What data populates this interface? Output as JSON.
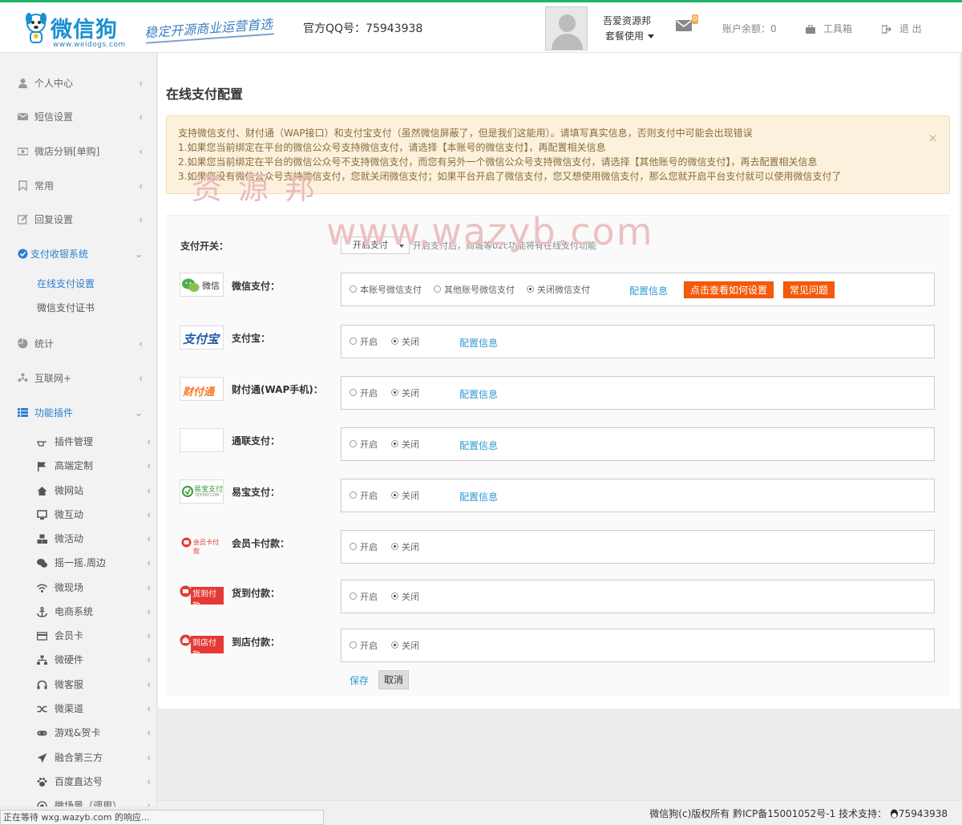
{
  "header": {
    "logo_text": "微信狗",
    "logo_sub": "www.weidogs.com",
    "slogan": "稳定开源商业运营首选",
    "qq_label": "官方QQ号：75943938",
    "user_name": "吾爱资源邦",
    "user_plan": "套餐使用",
    "mail_count": "0",
    "balance": "账户余额：0",
    "toolbox": "工具箱",
    "logout": "退 出"
  },
  "sidebar": {
    "items": [
      {
        "label": "个人中心"
      },
      {
        "label": "短信设置"
      },
      {
        "label": "微店分销[单购]"
      },
      {
        "label": "常用"
      },
      {
        "label": "回复设置"
      },
      {
        "label": "支付收银系统"
      },
      {
        "label": "统计"
      },
      {
        "label": "互联网+"
      },
      {
        "label": "功能插件"
      }
    ],
    "pay_sub": [
      "在线支付设置",
      "微信支付证书"
    ],
    "plugins": [
      "插件管理",
      "高端定制",
      "微网站",
      "微互动",
      "微活动",
      "摇一摇.周边",
      "微现场",
      "电商系统",
      "会员卡",
      "微硬件",
      "微客服",
      "微渠道",
      "游戏&贺卡",
      "融合第三方",
      "百度直达号",
      "微场景（调用）"
    ]
  },
  "main": {
    "title": "在线支付配置",
    "alert_lines": [
      "支持微信支付、财付通（WAP接口）和支付宝支付（虽然微信屏蔽了，但是我们这能用）。请填写真实信息，否则支付中可能会出现错误",
      "1.如果您当前绑定在平台的微信公众号支持微信支付，请选择【本账号的微信支付】，再配置相关信息",
      "2.如果您当前绑定在平台的微信公众号不支持微信支付，而您有另外一个微信公众号支持微信支付，请选择【其他账号的微信支付】，再去配置相关信息",
      "3.如果您没有微信公众号支持微信支付，您就关闭微信支付；如果平台开启了微信支付，您又想使用微信支付，那么您就开启平台支付就可以使用微信支付了"
    ],
    "alert_close": "×",
    "watermark_top": "资源邦",
    "watermark_main": "www.wazyb.com",
    "switch": {
      "label": "支付开关：",
      "selected": "开启支付",
      "help": "开启支付后，商城等b2c功能将有在线支付功能"
    },
    "wechat": {
      "logo_text": "微信",
      "label": "微信支付：",
      "options": [
        "本账号微信支付",
        "其他账号微信支付",
        "关闭微信支付"
      ],
      "config_link": "配置信息",
      "howto_button": "点击查看如何设置",
      "faq_button": "常见问题"
    },
    "on_label": "开启",
    "off_label": "关闭",
    "config_link": "配置信息",
    "methods": [
      {
        "logo": "支付宝",
        "label": "支付宝："
      },
      {
        "logo": "财付通",
        "label": "财付通(WAP手机)："
      },
      {
        "logo": "",
        "label": "通联支付："
      },
      {
        "logo": "易宝支付",
        "logo_sub": "YEEPAY.COM",
        "label": "易宝支付："
      },
      {
        "logo": "会员卡付款",
        "label": "会员卡付款："
      },
      {
        "logo": "货到付款",
        "label": "货到付款："
      },
      {
        "logo": "到店付款",
        "label": "到店付款："
      }
    ],
    "save": "保存",
    "cancel": "取消"
  },
  "footer": {
    "text": "微信狗(c)版权所有 黔ICP备15001052号-1 技术支持：",
    "qq": "75943938"
  },
  "statusbar": "正在等待 wxg.wazyb.com 的响应...",
  "colors": {
    "brand": "#1a8fd4",
    "link": "#2d9ad4",
    "active_nav": "#2a7fd0",
    "orange_button": "#f55a0a",
    "alert_bg": "#fcf1dc",
    "top_line": "#23b36b"
  }
}
